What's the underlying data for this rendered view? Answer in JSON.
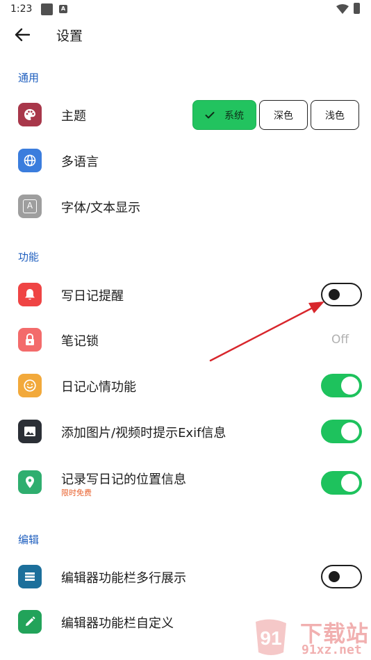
{
  "status": {
    "time": "1:23",
    "a_glyph": "A"
  },
  "header": {
    "title": "设置"
  },
  "sections": {
    "general": "通用",
    "features": "功能",
    "editor": "编辑"
  },
  "rows": {
    "theme": {
      "label": "主题"
    },
    "language": {
      "label": "多语言"
    },
    "font": {
      "label": "字体/文本显示",
      "icon_glyph": "A"
    },
    "reminder": {
      "label": "写日记提醒",
      "toggle": false
    },
    "lock": {
      "label": "笔记锁",
      "value": "Off"
    },
    "mood": {
      "label": "日记心情功能",
      "toggle": true
    },
    "exif": {
      "label": "添加图片/视频时提示Exif信息",
      "toggle": true
    },
    "location": {
      "label": "记录写日记的位置信息",
      "sublabel": "限时免费",
      "toggle": true
    },
    "multiline": {
      "label": "编辑器功能栏多行展示",
      "toggle": false
    },
    "custom": {
      "label": "编辑器功能栏自定义"
    }
  },
  "theme_options": {
    "system": "系统",
    "dark": "深色",
    "light": "浅色",
    "selected": "system"
  },
  "watermark": {
    "main": "下载站",
    "url": "91xz.net",
    "logo": "91"
  },
  "colors": {
    "accent_green": "#22c35f",
    "section_blue": "#1f5fbf",
    "icon_theme": "#a8374a",
    "icon_language": "#3b7ddd",
    "icon_font": "#9e9e9e",
    "icon_reminder": "#ef4444",
    "icon_lock": "#f36b6b",
    "icon_mood": "#f2a93b",
    "icon_exif": "#2b2f36",
    "icon_location": "#2fae6f",
    "icon_multiline": "#1c6f9b",
    "icon_custom": "#22a35a",
    "annotation_arrow": "#d8262c"
  },
  "icons": {
    "back": "arrow-left-icon",
    "theme": "palette-icon",
    "language": "globe-icon",
    "font": "font-a-icon",
    "reminder": "bell-icon",
    "lock": "lock-icon",
    "mood": "smiley-icon",
    "exif": "image-icon",
    "location": "location-pin-icon",
    "multiline": "list-icon",
    "custom": "pencil-icon",
    "check": "check-icon"
  }
}
